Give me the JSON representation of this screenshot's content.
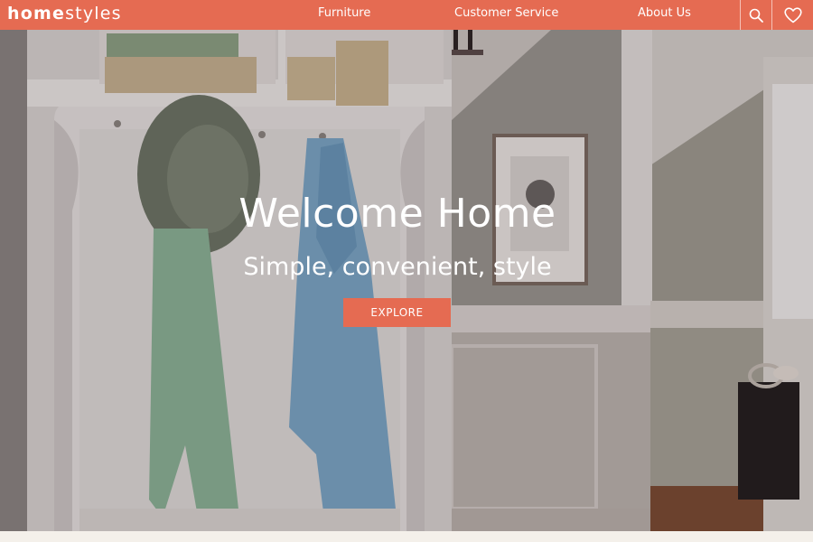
{
  "brand": {
    "bold": "home",
    "light": "styles"
  },
  "nav": {
    "links": [
      "Furniture",
      "Customer Service",
      "About Us"
    ],
    "search_icon": "search-icon",
    "wishlist_icon": "heart-icon"
  },
  "hero": {
    "title": "Welcome Home",
    "subtitle": "Simple, convenient, style",
    "cta_label": "EXPLORE"
  },
  "colors": {
    "accent": "#e56b52",
    "text_light": "#ffffff",
    "page_bg": "#f4f0ea"
  }
}
